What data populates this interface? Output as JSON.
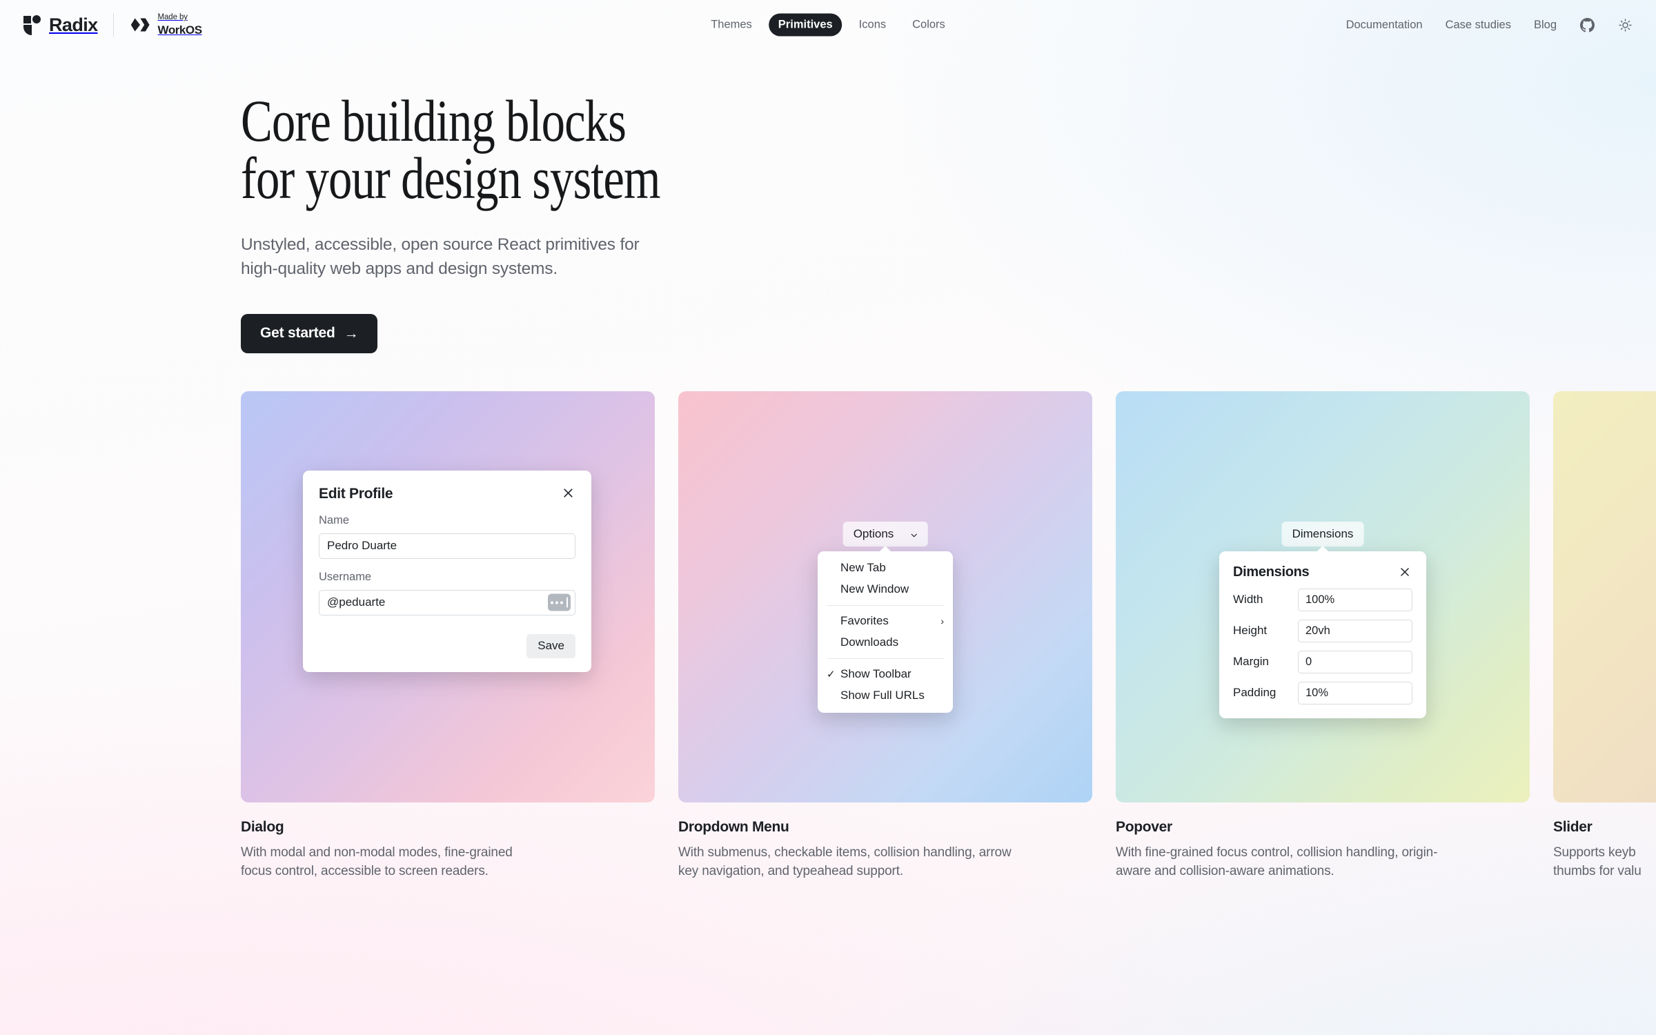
{
  "header": {
    "brand": {
      "radix_name": "Radix",
      "radix_logo_icon": "radix-logo-icon",
      "workos_made_by": "Made by",
      "workos_name": "WorkOS",
      "workos_logo_icon": "workos-logo-icon"
    },
    "center_nav": [
      {
        "label": "Themes",
        "active": false
      },
      {
        "label": "Primitives",
        "active": true
      },
      {
        "label": "Icons",
        "active": false
      },
      {
        "label": "Colors",
        "active": false
      }
    ],
    "right_nav": [
      {
        "label": "Documentation"
      },
      {
        "label": "Case studies"
      },
      {
        "label": "Blog"
      }
    ],
    "github_icon": "github-icon",
    "theme_toggle_icon": "sun-icon"
  },
  "hero": {
    "headline": "Core building blocks\nfor your design system",
    "subhead": "Unstyled, accessible, open source React primitives for\nhigh-quality web apps and design systems.",
    "cta_label": "Get started",
    "cta_arrow": "→"
  },
  "cards": [
    {
      "title": "Dialog",
      "description": "With modal and non-modal modes, fine-grained\nfocus control, accessible to screen readers.",
      "gradient": "g1",
      "demo": {
        "type": "dialog",
        "title": "Edit Profile",
        "close_icon": "close-icon",
        "fields": [
          {
            "label": "Name",
            "value": "Pedro Duarte"
          },
          {
            "label": "Username",
            "value": "@peduarte"
          }
        ],
        "save_label": "Save",
        "caret_chip_icon": "text-selection-handle-icon"
      }
    },
    {
      "title": "Dropdown Menu",
      "description": "With submenus, checkable items, collision handling, arrow\nkey navigation, and typeahead support.",
      "gradient": "g2",
      "demo": {
        "type": "dropdown",
        "trigger_label": "Options",
        "trigger_icon": "chevron-down-icon",
        "items": [
          {
            "label": "New Tab",
            "kind": "item"
          },
          {
            "label": "New Window",
            "kind": "item"
          },
          {
            "kind": "separator"
          },
          {
            "label": "Favorites",
            "kind": "submenu",
            "arrow": "›"
          },
          {
            "label": "Downloads",
            "kind": "item"
          },
          {
            "kind": "separator"
          },
          {
            "label": "Show Toolbar",
            "kind": "checkbox",
            "checked": true,
            "tick": "✓"
          },
          {
            "label": "Show Full URLs",
            "kind": "checkbox",
            "checked": false
          }
        ]
      }
    },
    {
      "title": "Popover",
      "description": "With fine-grained focus control, collision handling, origin-\naware and collision-aware animations.",
      "gradient": "g3",
      "demo": {
        "type": "popover",
        "trigger_label": "Dimensions",
        "title": "Dimensions",
        "close_icon": "close-icon",
        "rows": [
          {
            "label": "Width",
            "value": "100%"
          },
          {
            "label": "Height",
            "value": "20vh"
          },
          {
            "label": "Margin",
            "value": "0"
          },
          {
            "label": "Padding",
            "value": "10%"
          }
        ]
      }
    },
    {
      "title": "Slider",
      "description": "Supports keyb\nthumbs for valu",
      "gradient": "g4",
      "demo": {
        "type": "none"
      }
    }
  ]
}
